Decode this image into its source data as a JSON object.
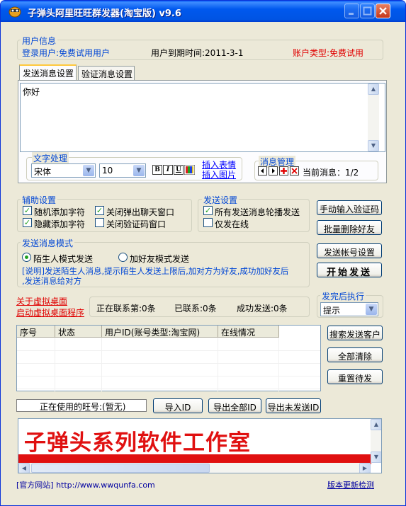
{
  "window": {
    "title": "子弹头阿里旺旺群发器(淘宝版) v9.6",
    "minimize_label": "_",
    "maximize_label": "□",
    "close_label": "✕"
  },
  "user_info": {
    "group_title": "用户信息",
    "login_user": "登录用户:免费试用用户",
    "expiry": "用户到期时间:2011-3-1",
    "account_type": "账户类型:免费试用"
  },
  "tabs": [
    "发送消息设置",
    "验证消息设置"
  ],
  "message": {
    "text": "你好"
  },
  "text_processing": {
    "group_title": "文字处理",
    "font": "宋体",
    "size": "10",
    "bold_label": "B",
    "italic_label": "I",
    "underline_label": "U",
    "insert_emoticon": "插入表情",
    "insert_image": "插入图片"
  },
  "message_management": {
    "group_title": "消息管理",
    "current": "当前消息：1/2"
  },
  "aux_settings": {
    "group_title": "辅助设置",
    "options": [
      {
        "label": "随机添加字符",
        "checked": "✓"
      },
      {
        "label": "关闭弹出聊天窗口",
        "checked": "✓"
      },
      {
        "label": "隐藏添加字符",
        "checked": "✓"
      },
      {
        "label": "关闭验证码窗口",
        "checked": ""
      }
    ]
  },
  "send_settings": {
    "group_title": "发送设置",
    "options": [
      {
        "label": "所有发送消息轮播发送",
        "checked": "✓"
      },
      {
        "label": "仅发在线",
        "checked": ""
      }
    ]
  },
  "send_mode": {
    "group_title": "发送消息模式",
    "stranger_mode": "陌生人模式发送",
    "friend_mode": "加好友模式发送",
    "note_line1": "[说明]发送陌生人消息,提示陌生人发送上限后,加对方为好友,成功加好友后",
    "note_line2": ",发送消息给对方"
  },
  "buttons": {
    "manual_captcha": "手动输入验证码",
    "batch_delete": "批量删除好友",
    "send_account_settings": "发送帐号设置",
    "start_send": "开始发送",
    "search_customers": "搜索发送客户",
    "clear_all": "全部清除",
    "reset_pending": "重置待发",
    "import_id": "导入ID",
    "export_all_id": "导出全部ID",
    "export_unsent_id": "导出未发送ID"
  },
  "virtual_desktop": {
    "about": "关于虚拟桌面",
    "launch": "启动虚拟桌面程序"
  },
  "stats": {
    "contacting": "正在联系第:0条",
    "contacted": "已联系:0条",
    "success": "成功发送:0条"
  },
  "after_send": {
    "group_title": "发完后执行",
    "selected": "提示"
  },
  "table": {
    "headers": [
      "序号",
      "状态",
      "用户ID(账号类型:淘宝网)",
      "在线情况"
    ]
  },
  "current_account": "正在使用的旺号:(暂无)",
  "banner": {
    "text": "子弹头系列软件工作室"
  },
  "footer": {
    "website": "[官方网站] http://www.wwqunfa.com",
    "update_check": "版本更新检测"
  }
}
